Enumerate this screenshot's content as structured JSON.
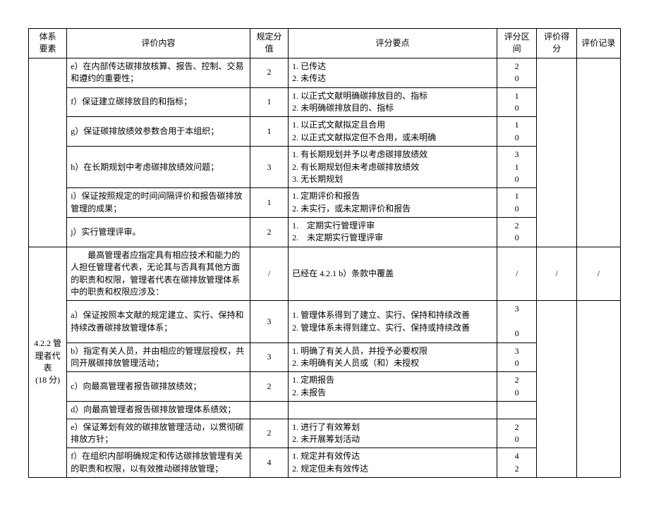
{
  "headers": {
    "system": "体系\n要素",
    "content": "评价内容",
    "value": "规定分值",
    "points": "评分要点",
    "range": "评分区间",
    "score": "评价得分",
    "record": "评价记录"
  },
  "section": {
    "id": "4.2.2 管\n理者代表\n(18 分)"
  },
  "rows": [
    {
      "grp": "upper",
      "content": "e）在内部传达碳排放核算、报告、控制、交易和遵约的重要性；",
      "value": "2",
      "points": "1. 已传达\n2. 未传达",
      "range": "2\n0"
    },
    {
      "grp": "upper",
      "content": "f）保证建立碳排放目的和指标；",
      "value": "1",
      "points": "1. 以正式文献明确碳排放目的、指标\n2. 未明确碳排放目的、指标",
      "range": "1\n0"
    },
    {
      "grp": "upper",
      "content": "g）保证碳排放绩效参数合用于本组织；",
      "value": "1",
      "points": "1. 以正式文献拟定且合用\n2. 以正式文献拟定但不合用，或未明确",
      "range": "1\n0"
    },
    {
      "grp": "upper",
      "content": "h）在长期规划中考虑碳排放绩效问题；",
      "value": "3",
      "points": "1. 有长期规划并予以考虑碳排放绩效\n2. 有长期规划但未考虑碳排放绩效\n3. 无长期规划",
      "range": "3\n1\n0"
    },
    {
      "grp": "upper",
      "content": "i）保证按照规定的时间间隔评价和报告碳排放管理的成果；",
      "value": "1",
      "points": "1. 定期评价和报告\n2. 未实行，或未定期评价和报告",
      "range": "1\n0"
    },
    {
      "grp": "upper",
      "content": "j）实行管理评审。",
      "value": "2",
      "points": "1.　定期实行管理评审\n2.　未定期实行管理评审",
      "range": "2\n0"
    },
    {
      "grp": "lower",
      "content": "　　最高管理者应指定具有相应技术和能力的人担任管理者代表，无论其与否具有其他方面的职责和权限，管理者代表在碳排放管理体系中的职责和权限应涉及：",
      "value": "/",
      "points": "已经在 4.2.1 b）条款中覆盖",
      "range": "/",
      "score": "/",
      "record": "/"
    },
    {
      "grp": "lower",
      "content": "a）保证按照本文献的规定建立、实行、保持和持续改善碳排放管理体系；",
      "value": "3",
      "points": "1. 管理体系得到了建立、实行、保持和持续改善\n2. 管理体系未得到建立、实行、保持或持续改善",
      "range": "3\n \n0"
    },
    {
      "grp": "lower",
      "content": "b）指定有关人员，并由相应的管理层授权，共同开展碳排放管理活动；",
      "value": "3",
      "points": "1. 明确了有关人员，并授予必要权限\n2. 未明确有关人员或（和）未授权",
      "range": "3\n0"
    },
    {
      "grp": "lower",
      "content": "c）向最高管理者报告碳排放绩效；",
      "value": "2",
      "points": "1. 定期报告\n2. 未报告",
      "range": "2\n0"
    },
    {
      "grp": "lower",
      "content": "d）向最高管理者报告碳排放管理体系绩效；",
      "value": "",
      "points": "",
      "range": ""
    },
    {
      "grp": "lower",
      "content": "e）保证筹划有效的碳排放管理活动，以贯彻碳排放方针；",
      "value": "2",
      "points": "1. 进行了有效筹划\n2. 未开展筹划活动",
      "range": "2\n0"
    },
    {
      "grp": "lower",
      "content": "f）在组织内部明确规定和传达碳排放管理有关的职责和权限，以有效推动碳排放管理；",
      "value": "4",
      "points": "1. 规定并有效传达\n2. 规定但未有效传达",
      "range": "4\n2"
    }
  ]
}
